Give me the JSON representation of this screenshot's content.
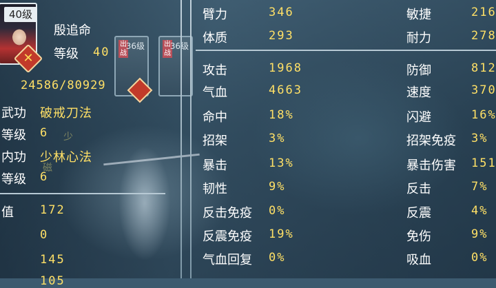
{
  "hero": {
    "level_tag": "40级",
    "name": "殷追命",
    "level_label": "等级",
    "level_value": "40",
    "exp": "24586/80929",
    "slot1_level": "36级",
    "slot2_level": "36级",
    "slot_tag": "出战"
  },
  "skills": {
    "martial_label": "武功",
    "martial_value": "破戒刀法",
    "martial_level_label": "等级",
    "martial_level_value": "6",
    "inner_label": "内功",
    "inner_value": "少林心法",
    "inner_level_label": "等级",
    "inner_level_value": "6",
    "faint1": "少",
    "faint2": "磁"
  },
  "values": {
    "label": "值",
    "v1": "172",
    "v2": "0",
    "v3": "145",
    "v4": "105"
  },
  "stats_left": [
    {
      "label": "臂力",
      "value": "346"
    },
    {
      "label": "体质",
      "value": "293"
    },
    {
      "label": "攻击",
      "value": "1968"
    },
    {
      "label": "气血",
      "value": "4663"
    },
    {
      "label": "命中",
      "value": "18%"
    },
    {
      "label": "招架",
      "value": "3%"
    },
    {
      "label": "暴击",
      "value": "13%"
    },
    {
      "label": "韧性",
      "value": "9%"
    },
    {
      "label": "反击免疫",
      "value": "0%"
    },
    {
      "label": "反震免疫",
      "value": "19%"
    },
    {
      "label": "气血回复",
      "value": "0%"
    }
  ],
  "stats_right": [
    {
      "label": "敏捷",
      "value": "216"
    },
    {
      "label": "耐力",
      "value": "278"
    },
    {
      "label": "防御",
      "value": "812"
    },
    {
      "label": "速度",
      "value": "370"
    },
    {
      "label": "闪避",
      "value": "16%"
    },
    {
      "label": "招架免疫",
      "value": "3%"
    },
    {
      "label": "暴击伤害",
      "value": "151"
    },
    {
      "label": "反击",
      "value": "7%"
    },
    {
      "label": "反震",
      "value": "4%"
    },
    {
      "label": "免伤",
      "value": "9%"
    },
    {
      "label": "吸血",
      "value": "0%"
    }
  ],
  "colors": {
    "stat_value": "#ffe066",
    "stat_label": "#ffffff",
    "divider": "#b7c9d4"
  }
}
